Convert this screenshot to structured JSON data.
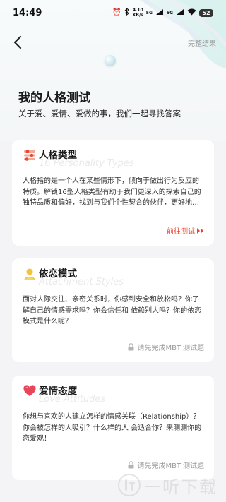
{
  "status": {
    "time": "14:49",
    "speed_value": "4.10",
    "speed_unit": "KB/s",
    "signal_1": "5G",
    "signal_2": "5G",
    "battery": "52"
  },
  "nav": {
    "action_label": "完整结果"
  },
  "header": {
    "title": "我的人格测试",
    "subtitle": "关于爱、爱情、爱做的事，我们一起寻找答案"
  },
  "cards": [
    {
      "title": "人格类型",
      "ghost": "16 Personality Types",
      "body": "人格指的是一个人在某些情形下，倾向于做出行为反应的特质。解锁16型人格类型有助于我们更深入的探索自己的独特品质和偏好，找到与我们个性契合的伙伴，更好地理解他人。",
      "action": "前往测试",
      "icon": "personality-type-icon",
      "accent": "#e8462e"
    },
    {
      "title": "依恋模式",
      "ghost": "Attachment Styles",
      "body": "面对人际交往、亲密关系时，你感到安全和放松吗？你了解自己的情感需求吗？你会信任和 依赖别人吗？你的依恋模式是什么呢？",
      "lock_text": "请先完成MBTI测试题",
      "icon": "attachment-style-icon",
      "accent": "#f4c23d"
    },
    {
      "title": "爱情态度",
      "ghost": "Love Attitudes",
      "body": "你想与喜欢的人建立怎样的情感关联（Relationship）？你会被怎样的人吸引？什么样的人 会适合你？来测测你的恋爱观！",
      "lock_text": "请先完成MBTI测试题",
      "icon": "heart-icon",
      "accent": "#e8465a"
    }
  ],
  "watermark": {
    "text": "一听下载"
  }
}
